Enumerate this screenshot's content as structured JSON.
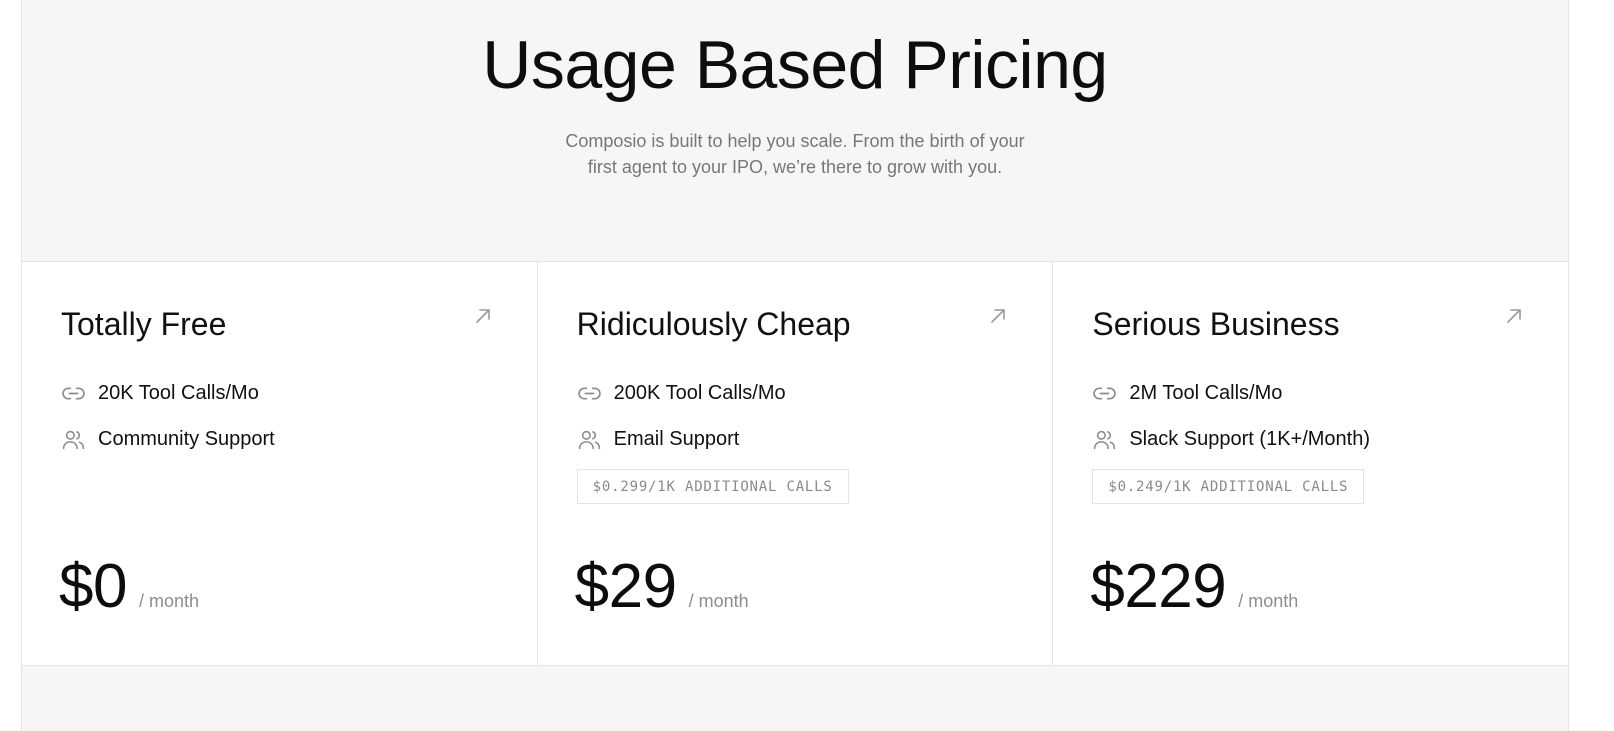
{
  "header": {
    "title": "Usage Based Pricing",
    "subtitle": "Composio is built to help you scale. From the birth of your first agent to your IPO, we’re there to grow with you."
  },
  "icons": {
    "card_link": "arrow-up-right-icon",
    "calls": "link-icon",
    "support": "users-icon"
  },
  "plans": [
    {
      "name": "Totally Free",
      "features": [
        "20K Tool Calls/Mo",
        "Community Support"
      ],
      "addon": "",
      "price": "$0",
      "period": "/ month"
    },
    {
      "name": "Ridiculously Cheap",
      "features": [
        "200K Tool Calls/Mo",
        "Email Support"
      ],
      "addon": "$0.299/1K ADDITIONAL CALLS",
      "price": "$29",
      "period": "/ month"
    },
    {
      "name": "Serious Business",
      "features": [
        "2M Tool Calls/Mo",
        "Slack Support (1K+/Month)"
      ],
      "addon": "$0.249/1K ADDITIONAL CALLS",
      "price": "$229",
      "period": "/ month"
    }
  ]
}
